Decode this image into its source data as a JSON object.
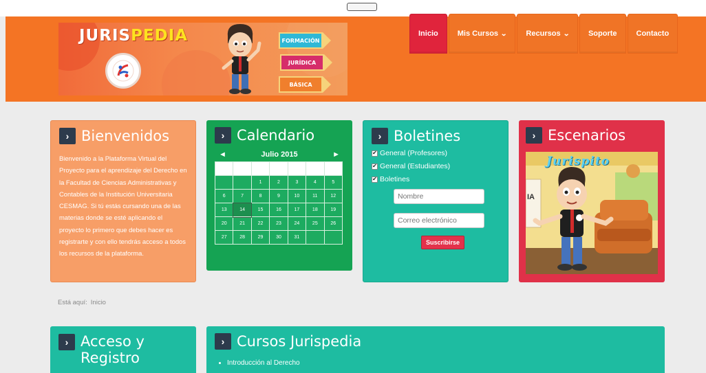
{
  "header": {
    "banner": {
      "title_part1": "JURIS",
      "title_part2": "PEDIA",
      "signs": [
        "FORMACIÓN",
        "JURÍDICA",
        "BÁSICA"
      ]
    },
    "nav": [
      {
        "label": "Inicio",
        "active": true,
        "has_dropdown": false
      },
      {
        "label": "Mis Cursos",
        "active": false,
        "has_dropdown": true
      },
      {
        "label": "Recursos",
        "active": false,
        "has_dropdown": true
      },
      {
        "label": "Soporte",
        "active": false,
        "has_dropdown": false
      },
      {
        "label": "Contacto",
        "active": false,
        "has_dropdown": false
      }
    ],
    "dropdown_glyph": "⌄"
  },
  "bienvenidos": {
    "title": "Bienvenidos",
    "text": "Bienvenido a la Plataforma Virtual del Proyecto para el aprendizaje del Derecho en la Facultad de Ciencias Administrativas y Contables de la Institución Universitaria CESMAG. Si tú estás cursando una de las materias donde se esté aplicando el proyecto lo primero que debes hacer es registrarte y con ello tendrás acceso a todos los recursos de la plataforma."
  },
  "calendario": {
    "title": "Calendario",
    "month_label": "Julio 2015",
    "prev_glyph": "◄",
    "next_glyph": "►",
    "weeks": [
      [
        "",
        "",
        "1",
        "2",
        "3",
        "4",
        "5"
      ],
      [
        "6",
        "7",
        "8",
        "9",
        "10",
        "11",
        "12"
      ],
      [
        "13",
        "14",
        "15",
        "16",
        "17",
        "18",
        "19"
      ],
      [
        "20",
        "21",
        "22",
        "23",
        "24",
        "25",
        "26"
      ],
      [
        "27",
        "28",
        "29",
        "30",
        "31",
        "",
        ""
      ]
    ],
    "today": "14"
  },
  "boletines": {
    "title": "Boletines",
    "checkboxes": [
      {
        "label": "General (Profesores)",
        "checked": true
      },
      {
        "label": "General (Estudiantes)",
        "checked": true
      },
      {
        "label": "Boletines",
        "checked": true
      }
    ],
    "name_placeholder": "Nombre",
    "email_placeholder": "Correo electrónico",
    "subscribe_label": "Suscribirse"
  },
  "escenarios": {
    "title": "Escenarios",
    "image_logo": "Jurispito",
    "wall_text": "IA"
  },
  "breadcrumb": {
    "prefix": "Está aquí:",
    "current": "Inicio"
  },
  "acceso": {
    "title": "Acceso y Registro"
  },
  "cursos": {
    "title": "Cursos Jurispedia",
    "items": [
      "Introducción al Derecho"
    ]
  },
  "colors": {
    "header_orange": "#f47424",
    "nav_active_red": "#e0243c",
    "bienvenidos_orange": "#f79e67",
    "calendar_green": "#15a353",
    "teal": "#1ebca1",
    "escenarios_red": "#e03149",
    "chevron_box_navy": "#2d3b4c"
  }
}
